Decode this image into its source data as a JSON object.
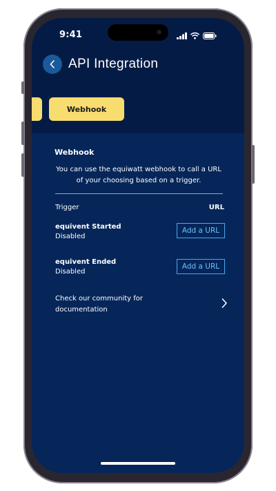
{
  "status_bar": {
    "time": "9:41",
    "icons": [
      "signal-icon",
      "wifi-icon",
      "battery-icon"
    ]
  },
  "header": {
    "back_icon": "chevron-left-icon",
    "title": "API Integration"
  },
  "tabs": {
    "items": [
      {
        "label": "",
        "state": "partially-visible"
      },
      {
        "label": "Webhook",
        "state": "active"
      }
    ]
  },
  "webhook": {
    "heading": "Webhook",
    "description": "You can use the equiwatt webhook to call a URL of your choosing based on a trigger.",
    "columns": {
      "trigger": "Trigger",
      "url": "URL"
    },
    "rows": [
      {
        "trigger": "equivent Started",
        "status": "Disabled",
        "button": "Add a URL"
      },
      {
        "trigger": "equivent Ended",
        "status": "Disabled",
        "button": "Add a URL"
      }
    ],
    "community": {
      "text": "Check our community for documentation",
      "icon": "chevron-right-icon"
    }
  },
  "colors": {
    "background": "#06265a",
    "header_background": "#041c45",
    "tab_active": "#f7dc6f",
    "link_button": "#4aa8ef",
    "back_button": "#1a5a9a"
  }
}
